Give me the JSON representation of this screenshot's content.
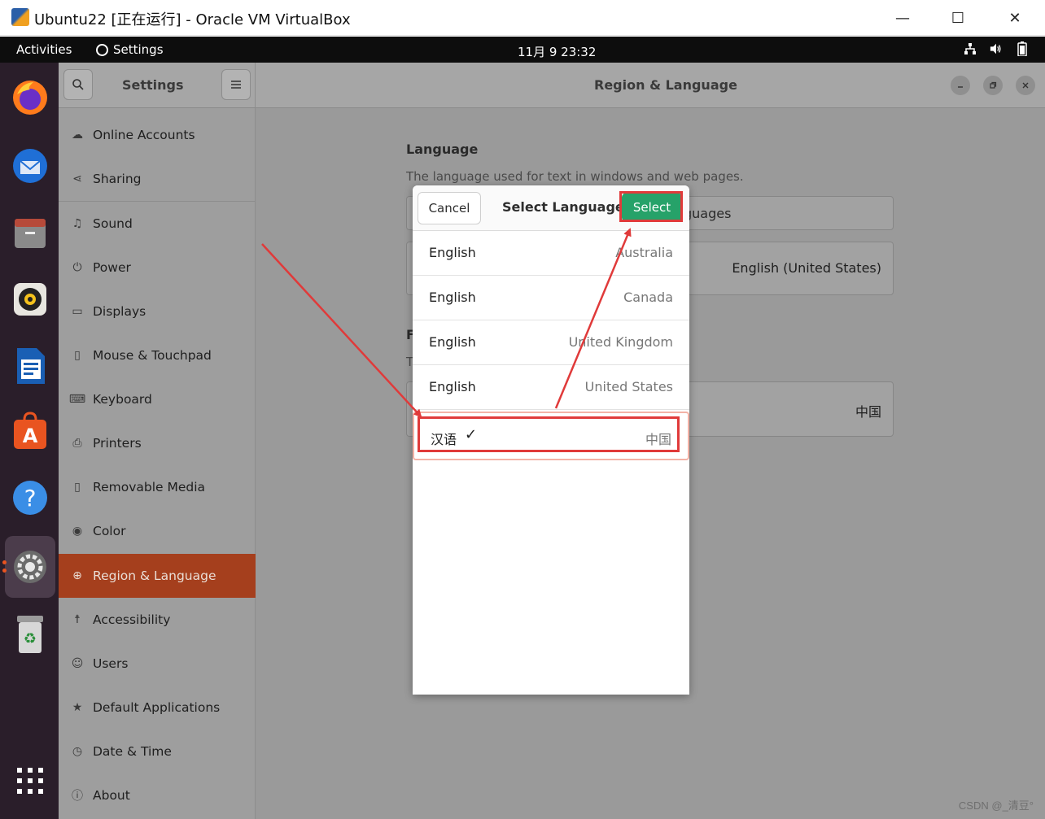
{
  "host_window": {
    "title": "Ubuntu22 [正在运行] - Oracle VM VirtualBox",
    "minimize_glyph": "—",
    "maximize_glyph": "☐",
    "close_glyph": "✕"
  },
  "topbar": {
    "activities": "Activities",
    "app_name": "Settings",
    "clock": "11月 9  23:32"
  },
  "dock": {
    "apps": [
      "firefox",
      "thunderbird",
      "files",
      "rhythmbox",
      "libreoffice-writer",
      "software",
      "help",
      "settings",
      "trash",
      "show-applications"
    ]
  },
  "settings": {
    "sidebar_title": "Settings",
    "panel_title": "Region & Language",
    "sidebar_items": [
      {
        "label": "Online Accounts",
        "icon": "cloud-icon"
      },
      {
        "label": "Sharing",
        "icon": "share-icon"
      },
      {
        "label": "Sound",
        "icon": "music-note-icon"
      },
      {
        "label": "Power",
        "icon": "power-icon"
      },
      {
        "label": "Displays",
        "icon": "display-icon"
      },
      {
        "label": "Mouse & Touchpad",
        "icon": "mouse-icon"
      },
      {
        "label": "Keyboard",
        "icon": "keyboard-icon"
      },
      {
        "label": "Printers",
        "icon": "printer-icon"
      },
      {
        "label": "Removable Media",
        "icon": "usb-drive-icon"
      },
      {
        "label": "Color",
        "icon": "color-icon"
      },
      {
        "label": "Region & Language",
        "icon": "globe-icon",
        "active": true
      },
      {
        "label": "Accessibility",
        "icon": "accessibility-icon"
      },
      {
        "label": "Users",
        "icon": "users-icon"
      },
      {
        "label": "Default Applications",
        "icon": "star-icon"
      },
      {
        "label": "Date & Time",
        "icon": "clock-icon"
      },
      {
        "label": "About",
        "icon": "info-icon"
      }
    ],
    "content": {
      "language_heading": "Language",
      "language_desc": "The language used for text in windows and web pages.",
      "manage_languages_partial": "guages",
      "current_language": "English (United States)",
      "formats_heading_partial": "F",
      "formats_desc_partial": "T",
      "formats_value": "中国"
    }
  },
  "dialog": {
    "cancel": "Cancel",
    "title": "Select Language",
    "select": "Select",
    "rows": [
      {
        "language": "English",
        "region": "Australia"
      },
      {
        "language": "English",
        "region": "Canada"
      },
      {
        "language": "English",
        "region": "United Kingdom"
      },
      {
        "language": "English",
        "region": "United States"
      },
      {
        "language": "汉语",
        "region": "中国",
        "selected": true,
        "check": "✓"
      }
    ]
  },
  "annotation_color": "#e03a3a",
  "accent_color": "#e95420",
  "select_button_color": "#26a269",
  "watermark": "CSDN @_清豆°"
}
